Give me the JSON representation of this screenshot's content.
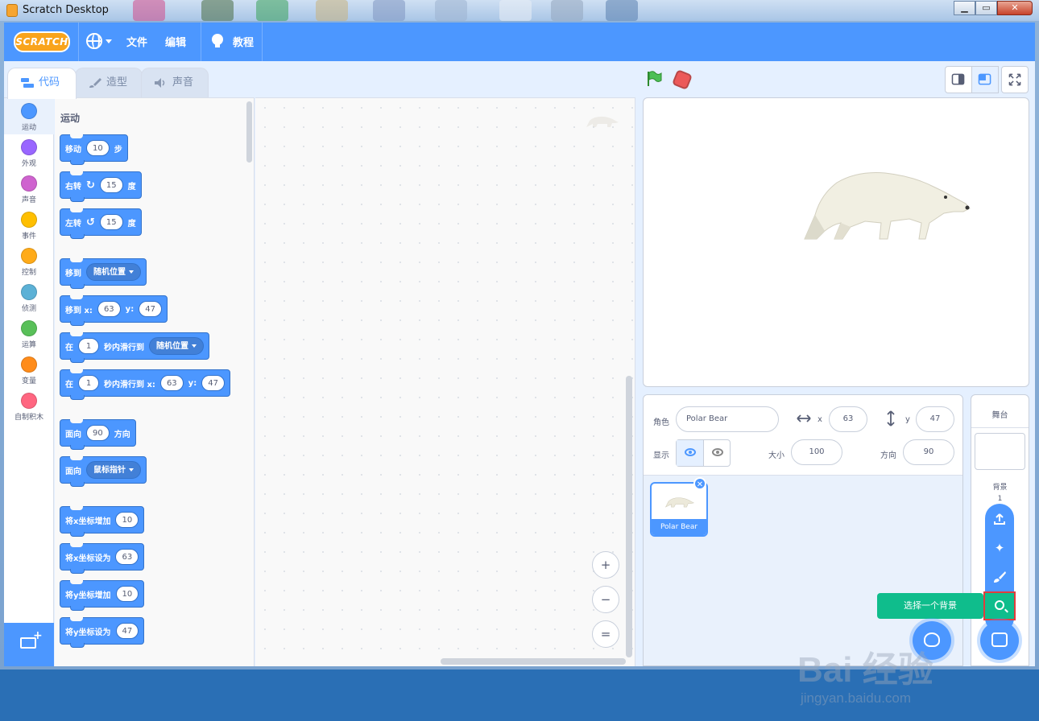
{
  "window": {
    "title": "Scratch Desktop",
    "min": "▁",
    "max": "▭",
    "close": "✕"
  },
  "menubar": {
    "logo": "SCRATCH",
    "file": "文件",
    "edit": "编辑",
    "tutorials": "教程",
    "accent": "#4c97ff"
  },
  "tabs": {
    "code": "代码",
    "costumes": "造型",
    "sounds": "声音"
  },
  "categories": [
    {
      "label": "运动",
      "color": "#4c97ff"
    },
    {
      "label": "外观",
      "color": "#9966ff"
    },
    {
      "label": "声音",
      "color": "#cf63cf"
    },
    {
      "label": "事件",
      "color": "#ffbf00"
    },
    {
      "label": "控制",
      "color": "#ffab19"
    },
    {
      "label": "侦测",
      "color": "#5cb1d6"
    },
    {
      "label": "运算",
      "color": "#59c059"
    },
    {
      "label": "变量",
      "color": "#ff8c1a"
    },
    {
      "label": "自制积木",
      "color": "#ff6680"
    }
  ],
  "flyout": {
    "section": "运动",
    "blocks": {
      "move": {
        "pre": "移动",
        "val": "10",
        "post": "步"
      },
      "turn_right": {
        "pre": "右转",
        "val": "15",
        "post": "度"
      },
      "turn_left": {
        "pre": "左转",
        "val": "15",
        "post": "度"
      },
      "goto": {
        "pre": "移到",
        "drop": "随机位置"
      },
      "goto_xy": {
        "pre": "移到 x:",
        "x": "63",
        "ylabel": "y:",
        "y": "47"
      },
      "glide": {
        "pre": "在",
        "val": "1",
        "mid": "秒内滑行到",
        "drop": "随机位置"
      },
      "glide_xy": {
        "pre": "在",
        "val": "1",
        "mid": "秒内滑行到 x:",
        "x": "63",
        "ylabel": "y:",
        "y": "47"
      },
      "point_dir": {
        "pre": "面向",
        "val": "90",
        "post": "方向"
      },
      "point_towards": {
        "pre": "面向",
        "drop": "鼠标指针"
      },
      "change_x": {
        "pre": "将x坐标增加",
        "val": "10"
      },
      "set_x": {
        "pre": "将x坐标设为",
        "val": "63"
      },
      "change_y": {
        "pre": "将y坐标增加",
        "val": "10"
      },
      "set_y": {
        "pre": "将y坐标设为",
        "val": "47"
      }
    }
  },
  "zoom": {
    "in": "+",
    "out": "−",
    "reset": "="
  },
  "sprite_info": {
    "sprite_label": "角色",
    "sprite_name": "Polar Bear",
    "x_label": "x",
    "x": "63",
    "y_label": "y",
    "y": "47",
    "show_label": "显示",
    "size_label": "大小",
    "size": "100",
    "direction_label": "方向",
    "direction": "90"
  },
  "sprite_list": [
    {
      "name": "Polar Bear"
    }
  ],
  "stage_panel": {
    "title": "舞台",
    "backdrops_label": "背景",
    "backdrops_count": "1"
  },
  "tooltip": "选择一个背景",
  "watermark": {
    "line1": "Bai 经验",
    "line2": "jingyan.baidu.com"
  }
}
